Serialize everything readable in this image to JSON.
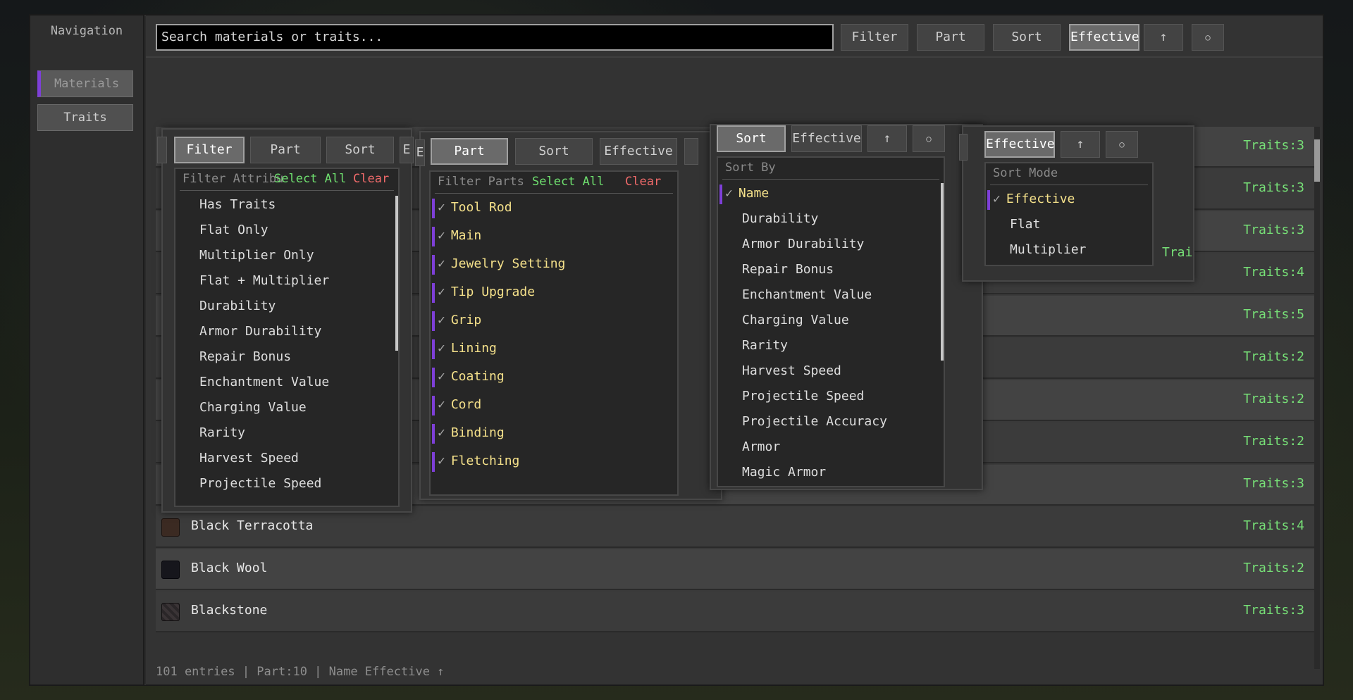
{
  "nav": {
    "title": "Navigation",
    "items": [
      {
        "label": "Materials"
      },
      {
        "label": "Traits"
      }
    ]
  },
  "toolbar": {
    "search_placeholder": "Search materials or traits...",
    "filter": "Filter",
    "part": "Part",
    "sort": "Sort",
    "effective": "Effective",
    "up": "↑",
    "reset": "○"
  },
  "rows": [
    {
      "name": "",
      "traits": "Traits:3"
    },
    {
      "name": "",
      "traits": "Traits:3"
    },
    {
      "name": "",
      "traits": "Traits:3"
    },
    {
      "name": "",
      "traits": "Traits:4"
    },
    {
      "name": "",
      "traits": "Traits:5"
    },
    {
      "name": "",
      "traits": "Traits:2"
    },
    {
      "name": "",
      "traits": "Traits:2"
    },
    {
      "name": "",
      "traits": "Traits:2"
    },
    {
      "name": "",
      "traits": "Traits:3"
    },
    {
      "name": "Black Terracotta",
      "traits": "Traits:4",
      "color": "#3b2a22"
    },
    {
      "name": "Black Wool",
      "traits": "Traits:2",
      "color": "#16161c"
    },
    {
      "name": "Blackstone",
      "traits": "Traits:3",
      "color": "#2a2628"
    }
  ],
  "status": "101 entries | Part:10 | Name Effective ↑",
  "filter_popup": {
    "header": "Filter Attribu",
    "select_all": "Select All",
    "clear": "Clear",
    "stub_e": "E",
    "items": [
      "Has Traits",
      "Flat Only",
      "Multiplier Only",
      "Flat + Multiplier",
      "Durability",
      "Armor Durability",
      "Repair Bonus",
      "Enchantment Value",
      "Charging Value",
      "Rarity",
      "Harvest Speed",
      "Projectile Speed"
    ]
  },
  "part_popup": {
    "stub_left": "E",
    "header": "Filter Parts",
    "select_all": "Select All",
    "clear": "Clear",
    "items": [
      "Tool Rod",
      "Main",
      "Jewelry Setting",
      "Tip Upgrade",
      "Grip",
      "Lining",
      "Coating",
      "Cord",
      "Binding",
      "Fletching"
    ]
  },
  "sort_popup": {
    "header": "Sort By",
    "items": [
      "Name",
      "Durability",
      "Armor Durability",
      "Repair Bonus",
      "Enchantment Value",
      "Charging Value",
      "Rarity",
      "Harvest Speed",
      "Projectile Speed",
      "Projectile Accuracy",
      "Armor",
      "Magic Armor"
    ]
  },
  "mode_popup": {
    "header": "Sort Mode",
    "items": [
      "Effective",
      "Flat",
      "Multiplier"
    ],
    "stub": "Trai"
  },
  "colors": {
    "accent": "#7e3fd8",
    "traits": "#77e077",
    "clear": "#ef6a6a"
  }
}
